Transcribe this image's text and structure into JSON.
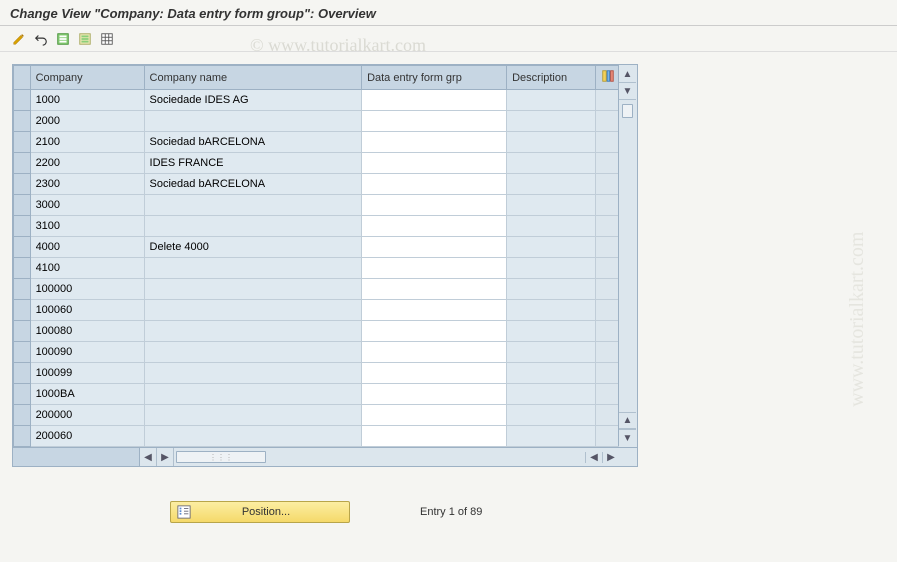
{
  "title": "Change View \"Company: Data entry form group\": Overview",
  "watermark": "© www.tutorialkart.com",
  "watermark2": "www.tutorialkart.com",
  "toolbar": {
    "items": [
      {
        "name": "toggle-change-icon"
      },
      {
        "name": "undo-icon"
      },
      {
        "name": "select-all-icon"
      },
      {
        "name": "deselect-all-icon"
      },
      {
        "name": "table-settings-icon"
      }
    ]
  },
  "columns": {
    "company": "Company",
    "company_name": "Company name",
    "form_grp": "Data entry form grp",
    "description": "Description"
  },
  "rows": [
    {
      "company": "1000",
      "name": "Sociedade IDES AG",
      "form": "",
      "desc": ""
    },
    {
      "company": "2000",
      "name": "",
      "form": "",
      "desc": ""
    },
    {
      "company": "2100",
      "name": "Sociedad bARCELONA",
      "form": "",
      "desc": ""
    },
    {
      "company": "2200",
      "name": "IDES FRANCE",
      "form": "",
      "desc": ""
    },
    {
      "company": "2300",
      "name": "Sociedad bARCELONA",
      "form": "",
      "desc": ""
    },
    {
      "company": "3000",
      "name": "",
      "form": "",
      "desc": ""
    },
    {
      "company": "3100",
      "name": "",
      "form": "",
      "desc": ""
    },
    {
      "company": "4000",
      "name": "Delete 4000",
      "form": "",
      "desc": ""
    },
    {
      "company": "4100",
      "name": "",
      "form": "",
      "desc": ""
    },
    {
      "company": "100000",
      "name": "",
      "form": "",
      "desc": ""
    },
    {
      "company": "100060",
      "name": "",
      "form": "",
      "desc": ""
    },
    {
      "company": "100080",
      "name": "",
      "form": "",
      "desc": ""
    },
    {
      "company": "100090",
      "name": "",
      "form": "",
      "desc": ""
    },
    {
      "company": "100099",
      "name": "",
      "form": "",
      "desc": ""
    },
    {
      "company": "1000BA",
      "name": "",
      "form": "",
      "desc": ""
    },
    {
      "company": "200000",
      "name": "",
      "form": "",
      "desc": ""
    },
    {
      "company": "200060",
      "name": "",
      "form": "",
      "desc": ""
    }
  ],
  "footer": {
    "position_label": "Position...",
    "entry_text": "Entry 1 of 89"
  }
}
